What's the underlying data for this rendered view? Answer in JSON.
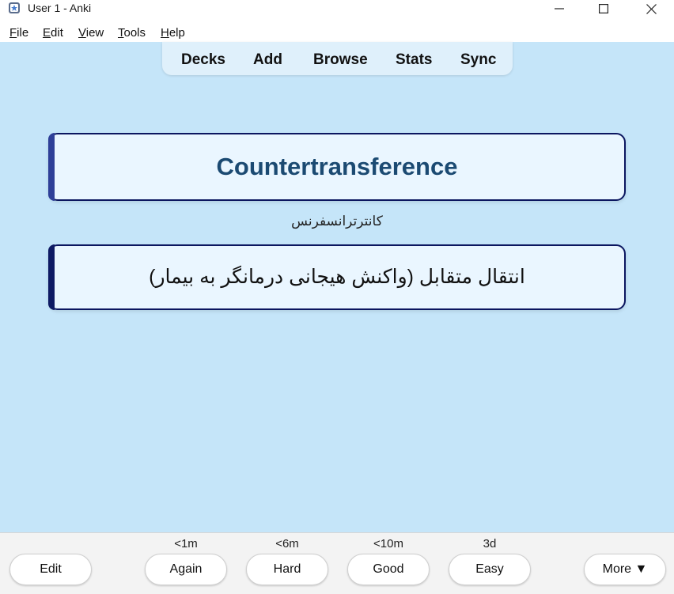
{
  "window": {
    "title": "User 1 - Anki"
  },
  "menu": [
    {
      "mnemonic": "F",
      "rest": "ile"
    },
    {
      "mnemonic": "E",
      "rest": "dit"
    },
    {
      "mnemonic": "V",
      "rest": "iew"
    },
    {
      "mnemonic": "T",
      "rest": "ools"
    },
    {
      "mnemonic": "H",
      "rest": "elp"
    }
  ],
  "toolbar": {
    "decks": "Decks",
    "add": "Add",
    "browse": "Browse",
    "stats": "Stats",
    "sync": "Sync"
  },
  "card": {
    "front": "Countertransference",
    "pronunciation": "کانترترانسفرنس",
    "back": "انتقال متقابل (واکنش هیجانی درمانگر به بیمار)"
  },
  "answer_bar": {
    "edit": "Edit",
    "more": "More ▼",
    "buttons": [
      {
        "label": "Again",
        "interval": "<1m"
      },
      {
        "label": "Hard",
        "interval": "<6m"
      },
      {
        "label": "Good",
        "interval": "<10m"
      },
      {
        "label": "Easy",
        "interval": "3d"
      }
    ]
  },
  "colors": {
    "background": "#c5e5f9",
    "card_border": "#0b1660",
    "front_text": "#1b4a72"
  },
  "icons": [
    "anki-app-icon",
    "minimize-icon",
    "maximize-icon",
    "close-icon"
  ]
}
